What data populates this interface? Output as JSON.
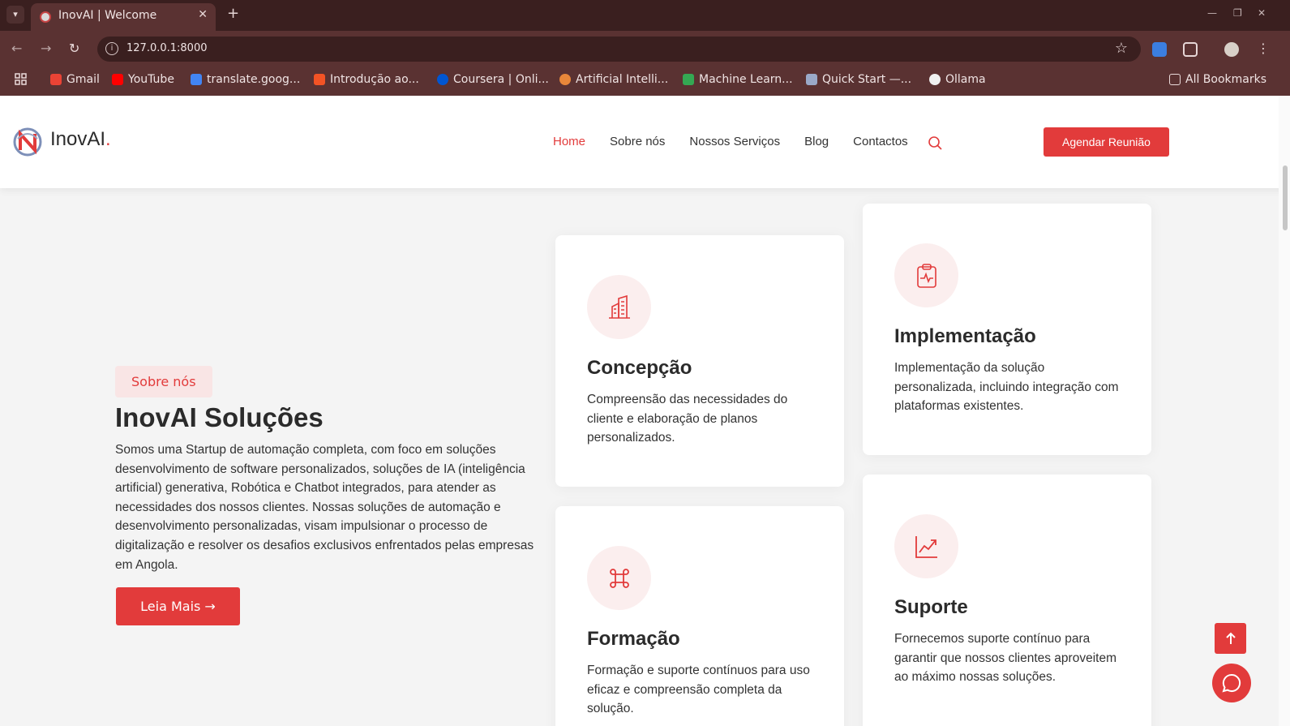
{
  "browser": {
    "tab_title": "InovAI | Welcome",
    "url": "127.0.0.1:8000",
    "bookmarks": [
      {
        "label": "Gmail",
        "icon": "gmail-icon"
      },
      {
        "label": "YouTube",
        "icon": "youtube-icon"
      },
      {
        "label": "translate.goog...",
        "icon": "translate-icon"
      },
      {
        "label": "Introdução ao...",
        "icon": "microsoft-icon"
      },
      {
        "label": "Coursera | Onli...",
        "icon": "coursera-icon"
      },
      {
        "label": "Artificial Intelli...",
        "icon": "ai-icon"
      },
      {
        "label": "Machine Learn...",
        "icon": "drive-icon"
      },
      {
        "label": "Quick Start —...",
        "icon": "doc-icon"
      },
      {
        "label": "Ollama",
        "icon": "ollama-icon"
      }
    ],
    "all_bookmarks": "All Bookmarks"
  },
  "header": {
    "brand": "InovAI",
    "brand_dot": ".",
    "nav": [
      "Home",
      "Sobre nós",
      "Nossos Serviços",
      "Blog",
      "Contactos"
    ],
    "cta": "Agendar Reunião"
  },
  "about": {
    "badge": "Sobre nós",
    "title": "InovAI Soluções",
    "text": "Somos uma Startup de automação completa, com foco em soluções desenvolvimento de software personalizados, soluções de IA (inteligência artificial) generativa, Robótica e Chatbot integrados, para atender as necessidades dos nossos clientes. Nossas soluções de automação e desenvolvimento personalizadas, visam impulsionar o processo de digitalização e resolver os desafios exclusivos enfrentados pelas empresas em Angola.",
    "button": "Leia Mais →"
  },
  "cards": [
    {
      "title": "Concepção",
      "text": "Compreensão das necessidades do cliente e elaboração de planos personalizados.",
      "icon": "building-icon"
    },
    {
      "title": "Implementação",
      "text": "Implementação da solução personalizada, incluindo integração com plataformas existentes.",
      "icon": "clipboard-pulse-icon"
    },
    {
      "title": "Formação",
      "text": "Formação e suporte contínuos para uso eficaz e compreensão completa da solução.",
      "icon": "command-icon"
    },
    {
      "title": "Suporte",
      "text": "Fornecemos suporte contínuo para garantir que nossos clientes aproveitem ao máximo nossas soluções.",
      "icon": "chart-line-icon"
    }
  ],
  "colors": {
    "accent": "#e23b3b",
    "badge_bg": "#f9e5e5",
    "icon_bg": "#fbeeee"
  }
}
